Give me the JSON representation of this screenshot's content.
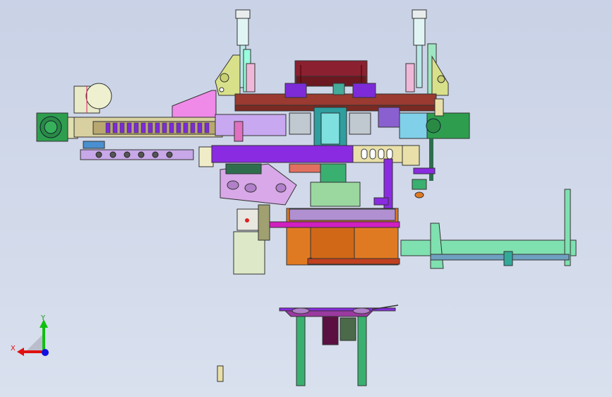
{
  "viewport": {
    "background": "#cfd7e8",
    "description_colors": {
      "purple": "#8a2be2",
      "brown": "#8b3a2e",
      "green": "#2e8b2e",
      "orange": "#e07a22",
      "teal": "#5ac9a8",
      "pink": "#e87de0",
      "olive": "#c8c88a",
      "cyan": "#7fd0e8",
      "khaki": "#e8e0a8"
    }
  },
  "triad": {
    "x_label": "X",
    "y_label": "Y",
    "x_color": "#e01010",
    "y_color": "#10c010",
    "z_color": "#1010e0"
  }
}
